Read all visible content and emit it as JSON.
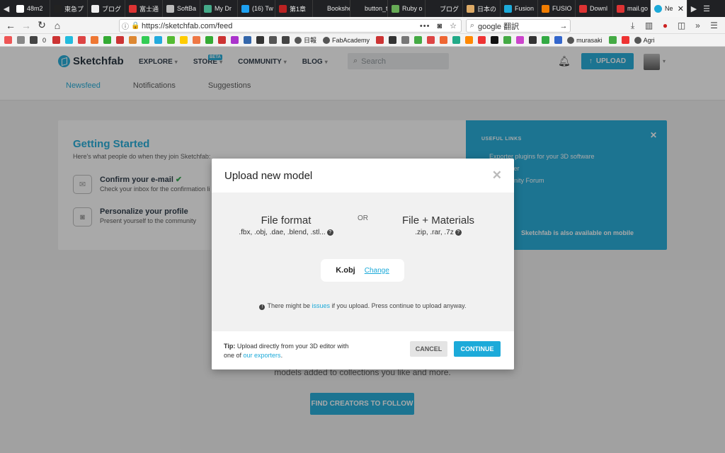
{
  "browser": {
    "tabs": [
      {
        "label": "48m2",
        "color": "#ffffff"
      },
      {
        "label": "東急プ",
        "color": "#222222"
      },
      {
        "label": "ブログ",
        "color": "#eeeeee"
      },
      {
        "label": "富士通",
        "color": "#d33"
      },
      {
        "label": "SoftBa",
        "color": "#bbbbbb"
      },
      {
        "label": "My Dr",
        "color": "#4a8"
      },
      {
        "label": "(16) Tw",
        "color": "#1da1f2"
      },
      {
        "label": "第1章",
        "color": "#b22"
      },
      {
        "label": "Bookshelf",
        "color": "#202124"
      },
      {
        "label": "button_to",
        "color": "#202124"
      },
      {
        "label": "Ruby o",
        "color": "#6a5"
      },
      {
        "label": "ブログ",
        "color": "#202124"
      },
      {
        "label": "日本の",
        "color": "#ddaa66"
      },
      {
        "label": "Fusion",
        "color": "#1caad9"
      },
      {
        "label": "FUSIO",
        "color": "#f07c00"
      },
      {
        "label": "Downl",
        "color": "#d33"
      },
      {
        "label": "mail.go",
        "color": "#d33"
      }
    ],
    "active_tab": "Ne",
    "url": "https://sketchfab.com/feed",
    "url_dots": "•••",
    "search_value": "google 翻訳",
    "bookmarks": [
      {
        "color": "#e55"
      },
      {
        "color": "#888"
      },
      {
        "color": "#444"
      },
      {
        "color": "#c33"
      },
      {
        "color": "#2bd"
      },
      {
        "color": "#d44"
      },
      {
        "color": "#e73"
      },
      {
        "color": "#3a3"
      },
      {
        "color": "#c33"
      },
      {
        "color": "#d83"
      },
      {
        "color": "#3c5"
      },
      {
        "color": "#2ad"
      },
      {
        "color": "#5b3"
      },
      {
        "color": "#fc0"
      },
      {
        "color": "#e74"
      },
      {
        "color": "#3a3"
      },
      {
        "color": "#c33"
      },
      {
        "color": "#a3c"
      },
      {
        "color": "#36a"
      },
      {
        "color": "#333"
      },
      {
        "color": "#555"
      },
      {
        "color": "#444"
      }
    ],
    "bookmark_labels": {
      "nikkei": "日報",
      "fabacademy": "FabAcademy",
      "murasaki": "murasaki",
      "agri": "Agri"
    },
    "toolbar_zero": "0"
  },
  "site": {
    "brand": "Sketchfab",
    "nav": [
      {
        "label": "EXPLORE"
      },
      {
        "label": "STORE"
      },
      {
        "label": "COMMUNITY"
      },
      {
        "label": "BLOG"
      }
    ],
    "beta_badge": "BETA",
    "search_placeholder": "Search",
    "upload_label": "UPLOAD",
    "subtabs": [
      "Newsfeed",
      "Notifications",
      "Suggestions"
    ],
    "getting_started": {
      "title": "Getting Started",
      "subtitle": "Here's what people do when they join Sketchfab:",
      "steps": [
        {
          "title": "Confirm your e-mail",
          "desc": "Check your inbox for the confirmation li"
        },
        {
          "title": "Personalize your profile",
          "desc": "Present yourself to the community"
        }
      ]
    },
    "useful_links": {
      "header": "USEFUL LINKS",
      "links": [
        "Exporter plugins for your 3D software",
        "ter",
        "nity Forum"
      ],
      "mobile": "Sketchfab is also available on mobile"
    },
    "promo_text": "models added to collections you like and more.",
    "follow_label": "FIND CREATORS TO FOLLOW"
  },
  "modal": {
    "title": "Upload new model",
    "file_format": {
      "title": "File format",
      "types": ".fbx, .obj, .dae, .blend, .stl..."
    },
    "or_label": "OR",
    "file_materials": {
      "title": "File + Materials",
      "types": ".zip, .rar, .7z"
    },
    "file_name": "K.obj",
    "change_label": "Change",
    "warning_prefix": "There might be ",
    "warning_link": "issues",
    "warning_suffix": " if you upload. Press continue to upload anyway.",
    "tip_label": "Tip:",
    "tip_text": " Upload directly from your 3D editor with one of ",
    "tip_link": "our exporters",
    "tip_end": ".",
    "cancel_label": "CANCEL",
    "continue_label": "CONTINUE"
  },
  "colors": {
    "accent": "#1caad9",
    "success": "#2aa84a"
  }
}
